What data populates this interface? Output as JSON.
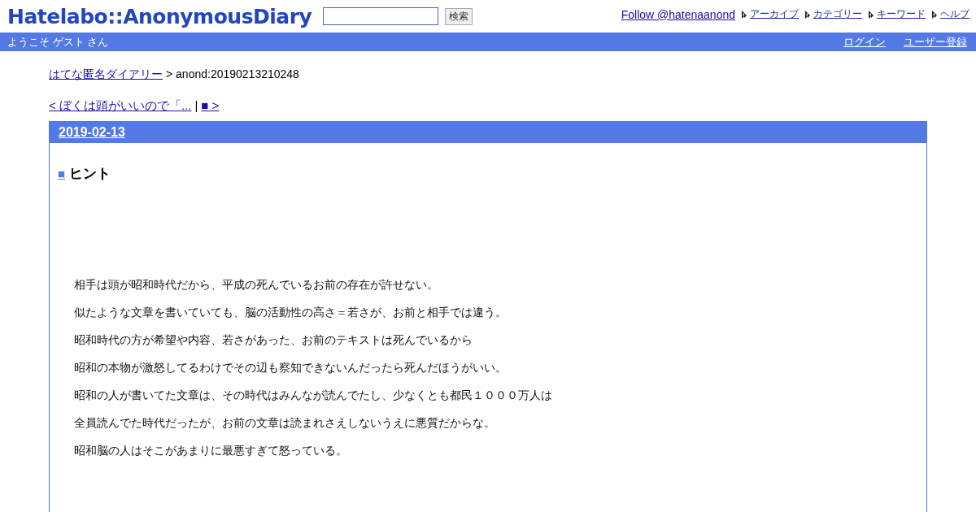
{
  "header": {
    "logo": "Hatelabo::AnonymousDiary",
    "search": {
      "button": "検索"
    },
    "follow": "Follow @hatenaanond",
    "nav": [
      "アーカイブ",
      "カテゴリー",
      "キーワード",
      "ヘルプ"
    ]
  },
  "welcome_bar": {
    "greeting": "ようこそ ゲスト さん",
    "links": [
      "ログイン",
      "ユーザー登録"
    ]
  },
  "breadcrumb": {
    "link": "はてな匿名ダイアリー",
    "current": "> anond:20190213210248"
  },
  "pager": {
    "prev": "< ぼくは頭がいいので「...",
    "separator": "|",
    "next": "■ >"
  },
  "day": {
    "date": "2019-02-13",
    "section": {
      "mark": "■",
      "title": "ヒント"
    },
    "paragraphs": [
      "相手は頭が昭和時代だから、平成の死んでいるお前の存在が許せない。",
      "似たような文章を書いていても、脳の活動性の高さ＝若さが、お前と相手では違う。",
      "昭和時代の方が希望や内容、若さがあった、お前のテキストは死んでいるから",
      "昭和の本物が激怒してるわけでその辺も察知できないんだったら死んだほうがいい。",
      "昭和の人が書いてた文章は、その時代はみんなが読んでたし、少なくとも都民１０００万人は",
      "全員読んでた時代だったが、お前の文章は読まれさえしないうえに悪質だからな。",
      "昭和脳の人はそこがあまりに最悪すぎて怒っている。"
    ]
  }
}
